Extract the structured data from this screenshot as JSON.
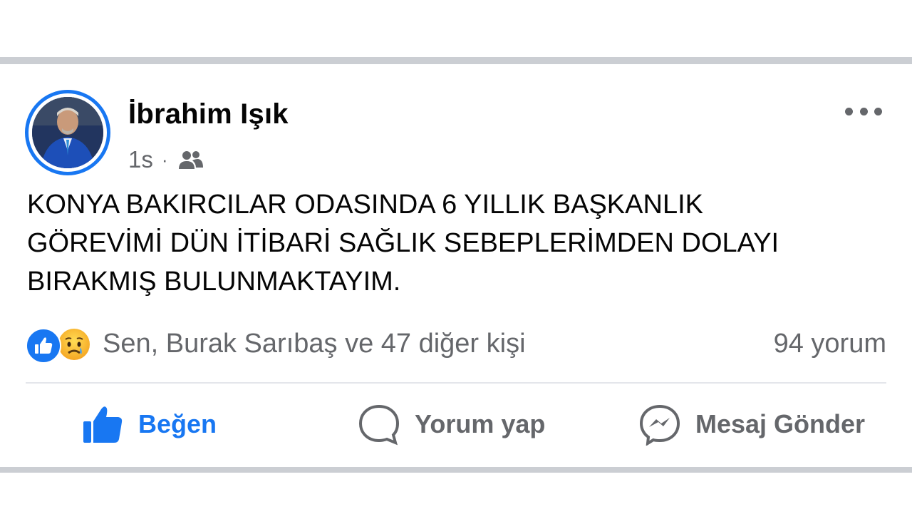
{
  "post": {
    "author": {
      "name": "İbrahim Işık",
      "avatar_icon": "profile-photo"
    },
    "meta": {
      "time": "1s",
      "separator": "·",
      "audience_icon": "friends-icon"
    },
    "more_icon": "more-horizontal-icon",
    "text": "KONYA BAKIRCILAR ODASINDA 6 YILLIK  BAŞKANLIK\nGÖREVİMİ DÜN İTİBARİ SAĞLIK SEBEPLERİMDEN DOLAYI\nBIRAKMIŞ BULUNMAKTAYIM.",
    "reactions": {
      "icons": [
        "like-reaction-icon",
        "sad-reaction-icon"
      ],
      "summary": "Sen, Burak Sarıbaş ve 47 diğer kişi",
      "comments": "94 yorum"
    },
    "actions": {
      "like": "Beğen",
      "comment": "Yorum yap",
      "message": "Mesaj Gönder"
    }
  },
  "colors": {
    "accent": "#1877f2",
    "secondary_text": "#65676b",
    "primary_text": "#050505",
    "separator": "#cbced3"
  }
}
